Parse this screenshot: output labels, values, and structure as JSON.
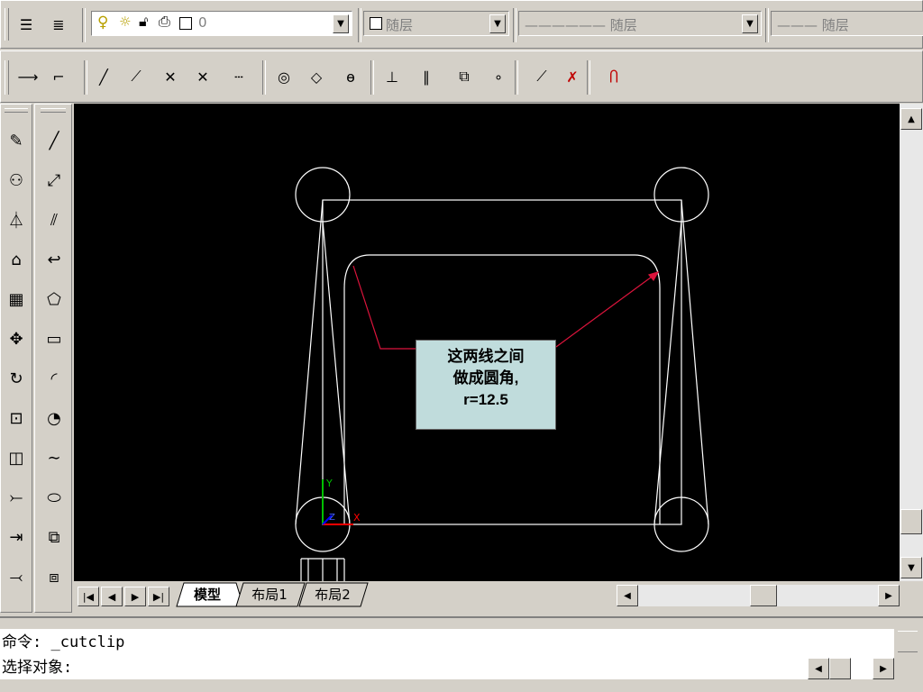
{
  "toolbar_top": {
    "layer_state_text": "0",
    "color_combo": "随层",
    "linetype_combo": "—————— 随层",
    "lineweight_combo": "——— 随层"
  },
  "snap_toolbar": {
    "icons": [
      "snap-from-icon",
      "tracking-icon",
      "endpoint-icon",
      "midpoint-icon",
      "intersection-icon",
      "apparent-intersection-icon",
      "extension-icon",
      "center-icon",
      "quadrant-icon",
      "tangent-icon",
      "perpendicular-icon",
      "parallel-icon",
      "insert-icon",
      "node-icon",
      "nearest-icon",
      "snap-none-icon",
      "osnap-settings-icon"
    ]
  },
  "modify_toolbar": {
    "icons": [
      "erase-icon",
      "copy-icon",
      "mirror-icon",
      "offset-icon",
      "array-icon",
      "move-icon",
      "rotate-icon",
      "scale-icon",
      "stretch-icon",
      "trim-icon",
      "extend-icon",
      "break-icon"
    ]
  },
  "draw_toolbar": {
    "icons": [
      "line-icon",
      "xline-icon",
      "multiline-icon",
      "polyline-icon",
      "polygon-icon",
      "rectangle-icon",
      "arc-icon",
      "circle-icon",
      "spline-icon",
      "ellipse-icon",
      "insert-block-icon",
      "make-block-icon"
    ]
  },
  "callout": {
    "line1": "这两线之间",
    "line2": "做成圆角,",
    "line3": "r=12.5"
  },
  "tabs": {
    "model": "模型",
    "layout1": "布局1",
    "layout2": "布局2"
  },
  "command": {
    "line1": "命令: _cutclip",
    "line2": "选择对象:"
  },
  "colors": {
    "canvas": "#000000",
    "drawing": "#ffffff",
    "leader": "#dc143c",
    "callout_bg": "#c0dcdc",
    "ucs_x": "#ff0000",
    "ucs_y": "#00c000",
    "ucs_z": "#0000ff"
  }
}
